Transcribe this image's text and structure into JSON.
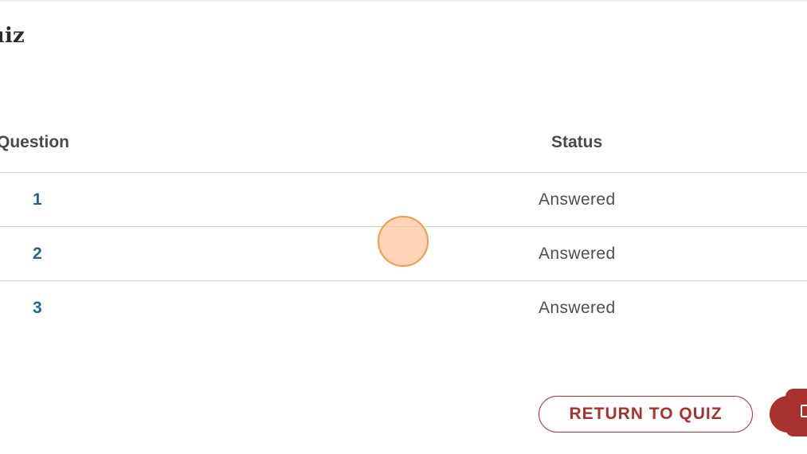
{
  "page": {
    "title": "Quiz"
  },
  "table": {
    "headers": {
      "question": "Question",
      "status": "Status"
    },
    "rows": [
      {
        "question": "1",
        "status": "Answered"
      },
      {
        "question": "2",
        "status": "Answered"
      },
      {
        "question": "3",
        "status": "Answered"
      }
    ]
  },
  "actions": {
    "return_label": "RETURN TO QUIZ"
  },
  "colors": {
    "accent": "#a8322e",
    "link": "#1d6793",
    "cursor_fill": "#ffc4a0",
    "cursor_stroke": "#f49a44"
  },
  "icons": {
    "next": "document-icon",
    "cursor": "click-indicator"
  }
}
